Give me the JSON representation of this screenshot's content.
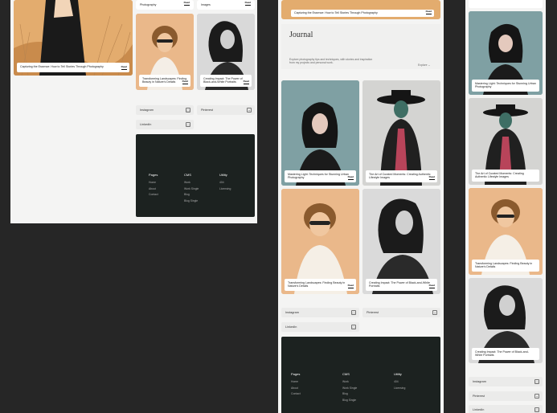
{
  "cards": {
    "c_cap": "Capturing the Essence: How to Tell Stories Through Photography",
    "c_light": "Mastering Light: Techniques for Stunning Urban Photography",
    "c_cult": "The Art of Curated Moments: Creating Authentic Lifestyle Images",
    "c_trans": "Transforming Landscapes: Finding Beauty in Nature's Details",
    "c_impact": "Creating Impact: The Power of Black-and-White Portraits",
    "left_small_1": "Photography",
    "left_small_2": "Images",
    "trans_short": "Transforming Landscapes: Finding Beauty in Nature's Details",
    "impact_short": "Creating Impact: The Power of Black-and-White Portraits",
    "read": "Read"
  },
  "journal": {
    "title": "Journal",
    "intro": "Explore photography tips and techniques, with stories and inspiration from my projects and personal work.",
    "filter": "Explore ⌄"
  },
  "social": {
    "instagram": "Instagram",
    "pinterest": "Pinterest",
    "linkedin": "LinkedIn",
    "icon_plus": "+",
    "icon_sq": "□"
  },
  "footer": {
    "col1": {
      "heading": "Pages",
      "items": [
        "Home",
        "About",
        "Contact"
      ]
    },
    "col2": {
      "heading": "CMS",
      "items": [
        "Work",
        "Work Single",
        "Blog",
        "Blog Single"
      ]
    },
    "col3": {
      "heading": "Utility",
      "items": [
        "404",
        "Licensing"
      ]
    }
  },
  "colors": {
    "background": "#262626",
    "frame": "#f4f4f3",
    "footer": "#1c2220",
    "accent_warm": "#e8b98a",
    "accent_teal": "#7fa1a4"
  }
}
